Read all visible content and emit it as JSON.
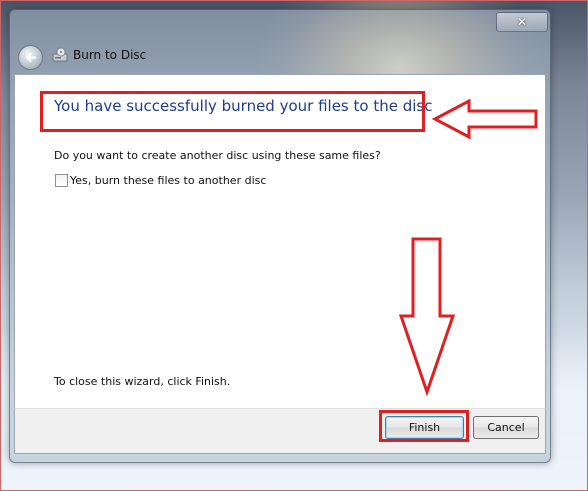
{
  "window": {
    "title": "Burn to Disc"
  },
  "titlebar": {
    "close_label": "✕"
  },
  "main": {
    "heading": "You have successfully burned your files to the disc",
    "question": "Do you want to create another disc using these same files?",
    "checkbox_label": "Yes, burn these files to another disc",
    "checkbox_checked": false,
    "close_note": "To close this wizard, click Finish."
  },
  "footer": {
    "finish_label": "Finish",
    "cancel_label": "Cancel"
  },
  "colors": {
    "heading": "#1e3d8f",
    "annotation": "#e02020"
  },
  "icons": [
    "back-arrow-icon",
    "burn-disc-icon",
    "close-icon"
  ]
}
